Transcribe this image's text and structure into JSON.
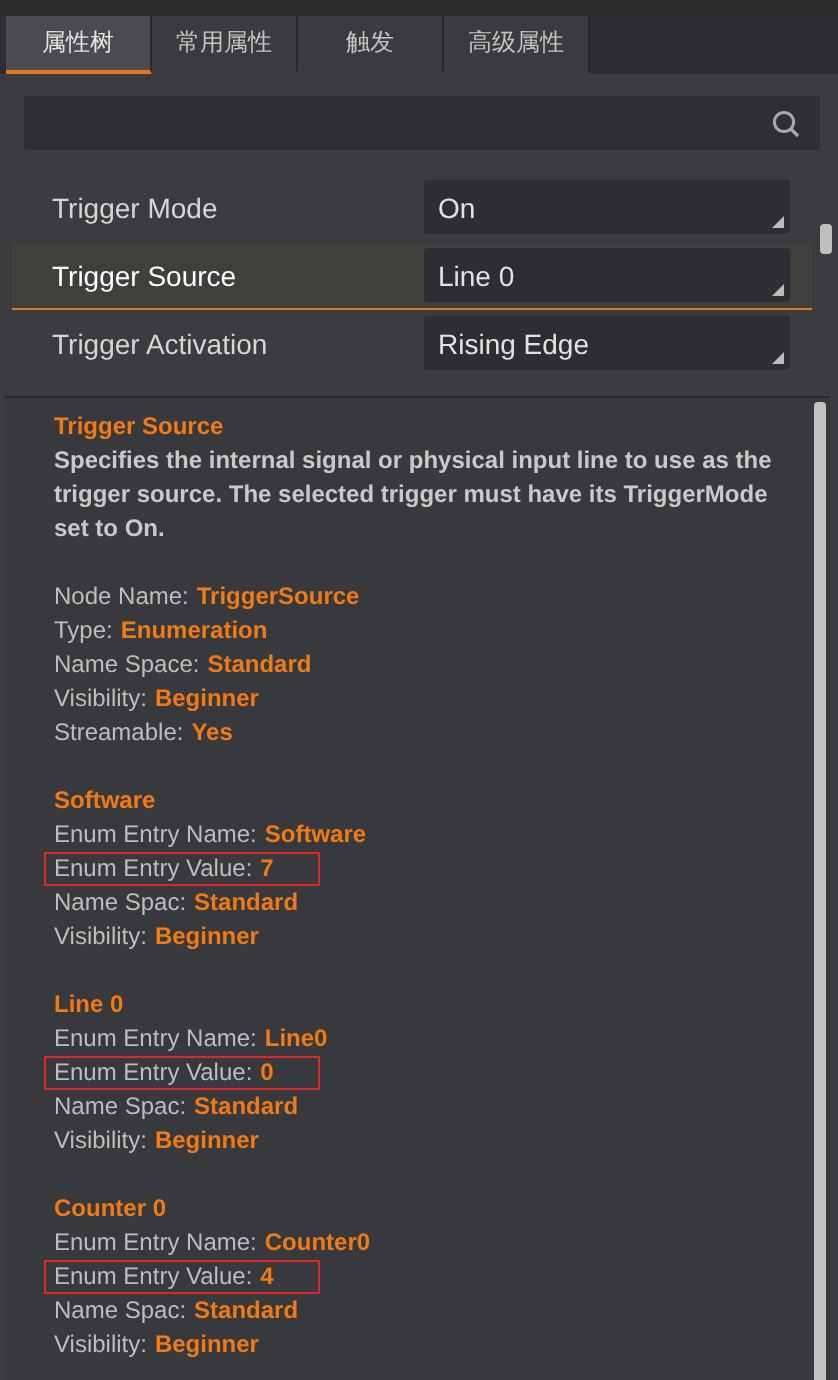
{
  "tabs": [
    {
      "label": "属性树",
      "selected": true
    },
    {
      "label": "常用属性",
      "selected": false
    },
    {
      "label": "触发",
      "selected": false
    },
    {
      "label": "高级属性",
      "selected": false
    }
  ],
  "properties": [
    {
      "name": "Trigger Mode",
      "value": "On",
      "selected": false
    },
    {
      "name": "Trigger Source",
      "value": "Line 0",
      "selected": true
    },
    {
      "name": "Trigger Activation",
      "value": "Rising Edge",
      "selected": false
    }
  ],
  "tooltip": {
    "title": "Trigger Source",
    "description": "Specifies the internal signal or physical input line to use as the trigger source. The selected trigger must have its TriggerMode set to On.",
    "details": [
      {
        "label": "Node Name:",
        "value": "TriggerSource",
        "highlighted": false
      },
      {
        "label": "Type:",
        "value": "Enumeration",
        "highlighted": false
      },
      {
        "label": "Name Space:",
        "value": "Standard",
        "highlighted": false
      },
      {
        "label": "Visibility:",
        "value": "Beginner",
        "highlighted": false
      },
      {
        "label": "Streamable:",
        "value": "Yes",
        "highlighted": false
      }
    ],
    "entries": [
      {
        "title": "Software",
        "lines": [
          {
            "label": "Enum Entry Name:",
            "value": "Software",
            "highlighted": false
          },
          {
            "label": "Enum Entry Value:",
            "value": "7",
            "highlighted": true
          },
          {
            "label": "Name Spac:",
            "value": "Standard",
            "highlighted": false
          },
          {
            "label": "Visibility:",
            "value": "Beginner",
            "highlighted": false
          }
        ]
      },
      {
        "title": "Line 0",
        "lines": [
          {
            "label": "Enum Entry Name:",
            "value": "Line0",
            "highlighted": false
          },
          {
            "label": "Enum Entry Value:",
            "value": "0",
            "highlighted": true
          },
          {
            "label": "Name Spac:",
            "value": "Standard",
            "highlighted": false
          },
          {
            "label": "Visibility:",
            "value": "Beginner",
            "highlighted": false
          }
        ]
      },
      {
        "title": "Counter 0",
        "lines": [
          {
            "label": "Enum Entry Name:",
            "value": "Counter0",
            "highlighted": false
          },
          {
            "label": "Enum Entry Value:",
            "value": "4",
            "highlighted": true
          },
          {
            "label": "Name Spac:",
            "value": "Standard",
            "highlighted": false
          },
          {
            "label": "Visibility:",
            "value": "Beginner",
            "highlighted": false
          }
        ]
      }
    ]
  }
}
